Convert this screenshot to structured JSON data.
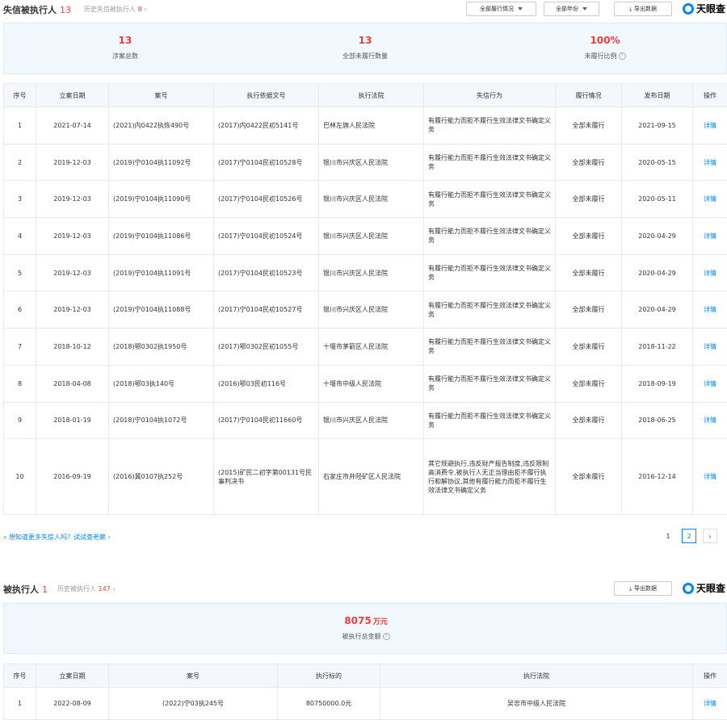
{
  "section1": {
    "title": "失信被执行人",
    "count": "13",
    "history_label": "历史失信被执行人",
    "history_count": "8",
    "filter_perform": "全部履行情况",
    "filter_year": "全部年份",
    "export_label": "导出数据",
    "logo_text": "天眼查",
    "stats": [
      {
        "value": "13",
        "label": "涉案总数"
      },
      {
        "value": "13",
        "label": "全部未履行数量"
      },
      {
        "value": "100%",
        "label": "未履行比例"
      }
    ],
    "columns": [
      "序号",
      "立案日期",
      "案号",
      "执行依据文号",
      "执行法院",
      "失信行为",
      "履行情况",
      "发布日期",
      "操作"
    ],
    "rows": [
      [
        "1",
        "2021-07-14",
        "(2021)内0422执恢490号",
        "(2017)内0422民初5141号",
        "巴林左旗人民法院",
        "有履行能力而拒不履行生效法律文书确定义务",
        "全部未履行",
        "2021-09-15",
        "详情"
      ],
      [
        "2",
        "2019-12-03",
        "(2019)宁0104执11092号",
        "(2017)宁0104民初10528号",
        "银川市兴庆区人民法院",
        "有履行能力而拒不履行生效法律文书确定义务",
        "全部未履行",
        "2020-05-15",
        "详情"
      ],
      [
        "3",
        "2019-12-03",
        "(2019)宁0104执11090号",
        "(2017)宁0104民初10526号",
        "银川市兴庆区人民法院",
        "有履行能力而拒不履行生效法律文书确定义务",
        "全部未履行",
        "2020-05-11",
        "详情"
      ],
      [
        "4",
        "2019-12-03",
        "(2019)宁0104执11086号",
        "(2017)宁0104民初10524号",
        "银川市兴庆区人民法院",
        "有履行能力而拒不履行生效法律文书确定义务",
        "全部未履行",
        "2020-04-29",
        "详情"
      ],
      [
        "5",
        "2019-12-03",
        "(2019)宁0104执11091号",
        "(2017)宁0104民初10523号",
        "银川市兴庆区人民法院",
        "有履行能力而拒不履行生效法律文书确定义务",
        "全部未履行",
        "2020-04-29",
        "详情"
      ],
      [
        "6",
        "2019-12-03",
        "(2019)宁0104执11088号",
        "(2017)宁0104民初10527号",
        "银川市兴庆区人民法院",
        "有履行能力而拒不履行生效法律文书确定义务",
        "全部未履行",
        "2020-04-29",
        "详情"
      ],
      [
        "7",
        "2018-10-12",
        "(2018)鄂0302执1950号",
        "(2017)鄂0302民初1055号",
        "十堰市茅箭区人民法院",
        "有履行能力而拒不履行生效法律文书确定义务",
        "全部未履行",
        "2018-11-22",
        "详情"
      ],
      [
        "8",
        "2018-04-08",
        "(2018)鄂03执140号",
        "(2016)鄂03民初116号",
        "十堰市中级人民法院",
        "有履行能力而拒不履行生效法律文书确定义务",
        "全部未履行",
        "2018-09-19",
        "详情"
      ],
      [
        "9",
        "2018-01-19",
        "(2018)宁0104执1072号",
        "(2017)宁0104民初11660号",
        "银川市兴庆区人民法院",
        "有履行能力而拒不履行生效法律文书确定义务",
        "全部未履行",
        "2018-06-25",
        "详情"
      ],
      [
        "10",
        "2016-09-19",
        "(2016)冀0107执252号",
        "(2015)矿民二初字第00131号民事判决书",
        "石家庄市井陉矿区人民法院",
        "其它规避执行,违反财产报告制度,违反限制高消费令,被执行人无正当理由拒不履行执行和解协议,其他有履行能力而拒不履行生效法律文书确定义务",
        "全部未履行",
        "2016-12-14",
        "详情"
      ]
    ],
    "hint": "想知道更多失信人吗？试试查老赖",
    "pages": [
      "1",
      "2"
    ],
    "next_symbol": "›"
  },
  "section2": {
    "title": "被执行人",
    "count": "1",
    "history_label": "历史被执行人",
    "history_count": "147",
    "export_label": "导出数据",
    "logo_text": "天眼查",
    "amount_value": "8075",
    "amount_unit": "万元",
    "amount_label": "被执行总金额",
    "columns": [
      "序号",
      "立案日期",
      "案号",
      "执行标的",
      "执行法院",
      "操作"
    ],
    "rows": [
      [
        "1",
        "2022-08-09",
        "(2022)宁03执245号",
        "80750000.0元",
        "吴忠市中级人民法院",
        "详情"
      ]
    ]
  },
  "colors": {
    "accent": "#0084ff",
    "red": "#f03c3c"
  }
}
